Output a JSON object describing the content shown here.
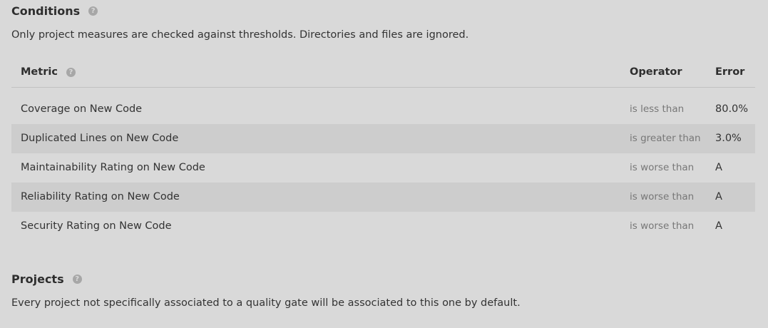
{
  "conditions": {
    "title": "Conditions",
    "description": "Only project measures are checked against thresholds. Directories and files are ignored.",
    "help_glyph": "?",
    "table": {
      "headers": {
        "metric": "Metric",
        "operator": "Operator",
        "error": "Error"
      },
      "rows": [
        {
          "metric": "Coverage on New Code",
          "operator": "is less than",
          "error": "80.0%"
        },
        {
          "metric": "Duplicated Lines on New Code",
          "operator": "is greater than",
          "error": "3.0%"
        },
        {
          "metric": "Maintainability Rating on New Code",
          "operator": "is worse than",
          "error": "A"
        },
        {
          "metric": "Reliability Rating on New Code",
          "operator": "is worse than",
          "error": "A"
        },
        {
          "metric": "Security Rating on New Code",
          "operator": "is worse than",
          "error": "A"
        }
      ]
    }
  },
  "projects": {
    "title": "Projects",
    "description": "Every project not specifically associated to a quality gate will be associated to this one by default."
  },
  "colors": {
    "background": "#d9d9d9",
    "row_shaded": "#cdcdcd",
    "text": "#333333",
    "muted_text": "#777777",
    "help_icon": "#a7a7a7"
  }
}
